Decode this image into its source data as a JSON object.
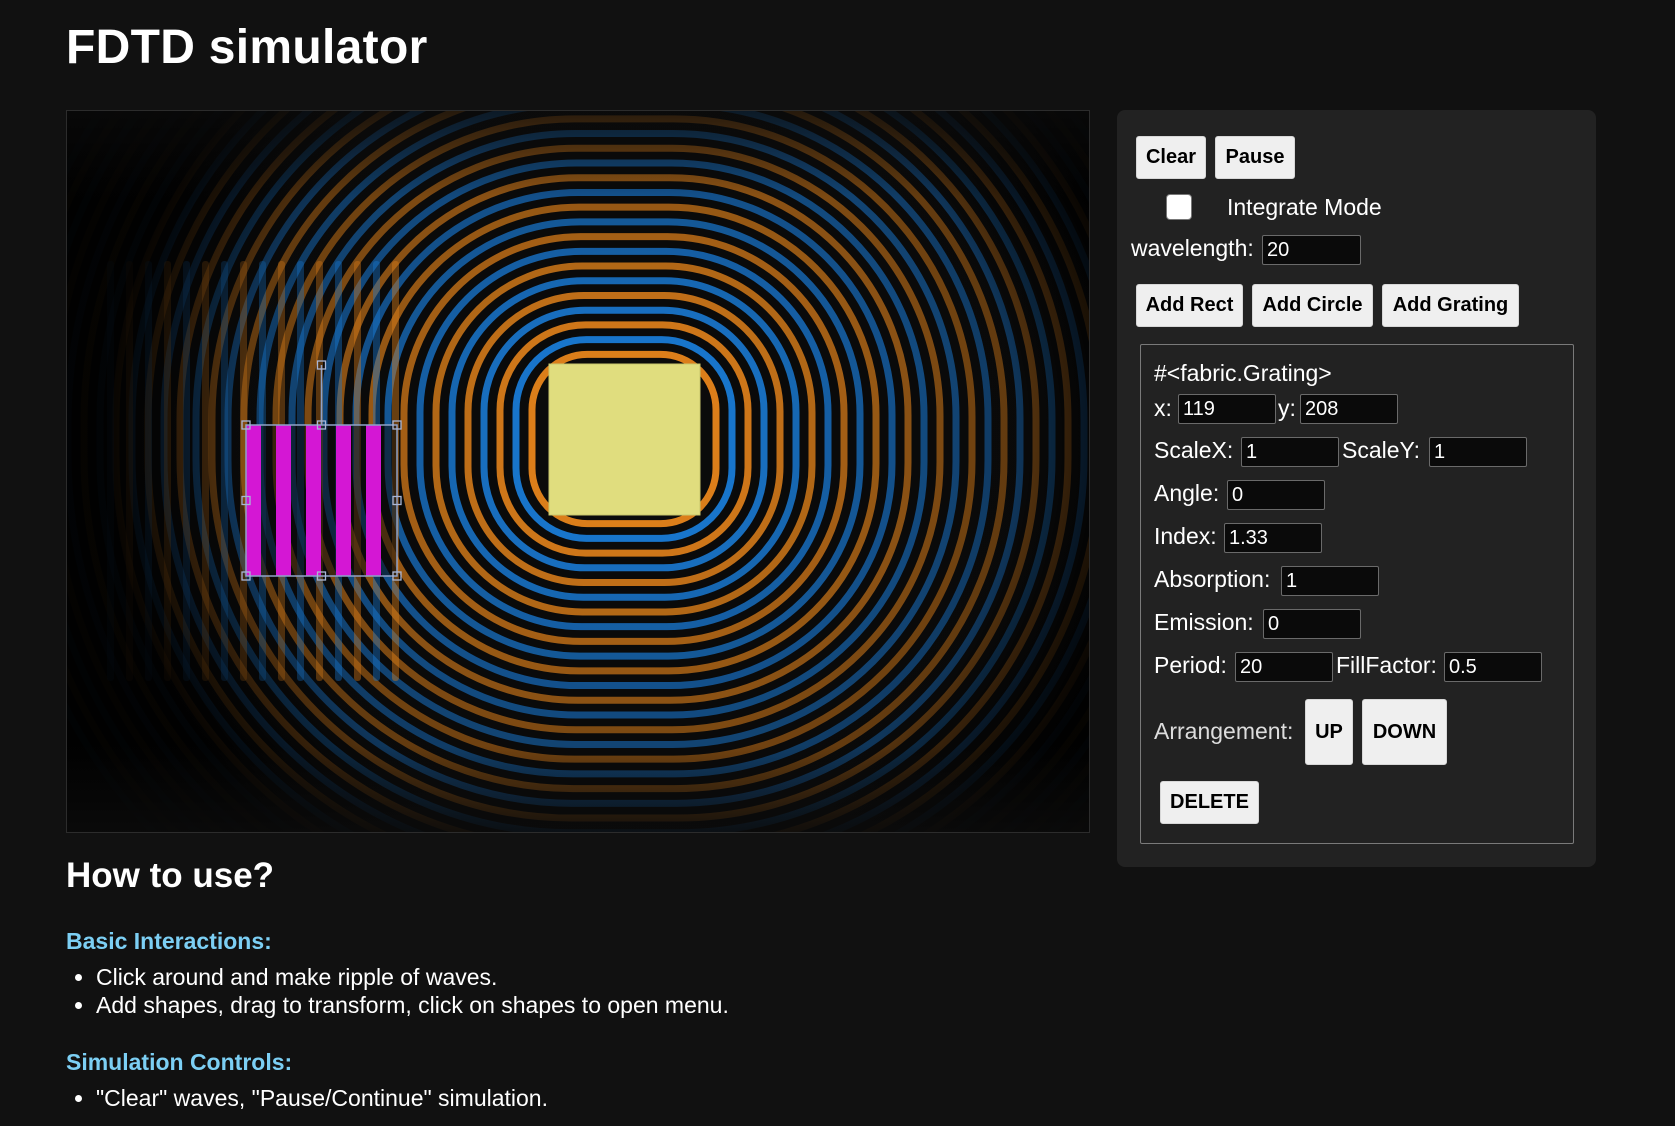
{
  "page": {
    "title": "FDTD simulator"
  },
  "simulation": {
    "shapes": [
      {
        "type": "rect",
        "fill": "#e0dd7e"
      },
      {
        "type": "grating",
        "bar_color": "#d417d4",
        "selected": true
      }
    ],
    "wave_colors": {
      "positive": "#f08a1c",
      "negative": "#1b84e6"
    }
  },
  "controls": {
    "clear_label": "Clear",
    "pause_label": "Pause",
    "integrate_mode_label": "Integrate Mode",
    "integrate_mode_checked": false,
    "wavelength_label": "wavelength:",
    "wavelength_value": "20",
    "add_rect_label": "Add Rect",
    "add_circle_label": "Add Circle",
    "add_grating_label": "Add Grating"
  },
  "properties": {
    "header": "#<fabric.Grating>",
    "x_label": "x:",
    "x_value": "119",
    "y_label": "y:",
    "y_value": "208",
    "scalex_label": "ScaleX:",
    "scalex_value": "1",
    "scaley_label": "ScaleY:",
    "scaley_value": "1",
    "angle_label": "Angle:",
    "angle_value": "0",
    "index_label": "Index:",
    "index_value": "1.33",
    "absorption_label": "Absorption:",
    "absorption_value": "1",
    "emission_label": "Emission:",
    "emission_value": "0",
    "period_label": "Period:",
    "period_value": "20",
    "fillfactor_label": "FillFactor:",
    "fillfactor_value": "0.5",
    "arrangement_label": "Arrangement:",
    "up_label": "UP",
    "down_label": "DOWN",
    "delete_label": "DELETE"
  },
  "howto": {
    "title": "How to use?",
    "basic_title": "Basic Interactions:",
    "basic_items": [
      "Click around and make ripple of waves.",
      "Add shapes, drag to transform, click on shapes to open menu."
    ],
    "sim_title": "Simulation Controls:",
    "sim_items": [
      "\"Clear\" waves, \"Pause/Continue\" simulation."
    ]
  }
}
